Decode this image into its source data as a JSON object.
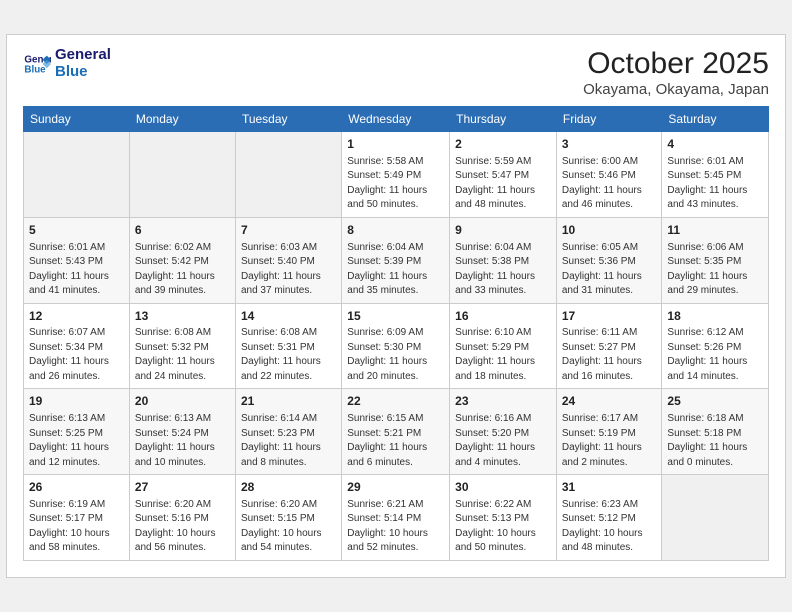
{
  "header": {
    "logo_line1": "General",
    "logo_line2": "Blue",
    "month": "October 2025",
    "location": "Okayama, Okayama, Japan"
  },
  "weekdays": [
    "Sunday",
    "Monday",
    "Tuesday",
    "Wednesday",
    "Thursday",
    "Friday",
    "Saturday"
  ],
  "weeks": [
    [
      {
        "day": "",
        "info": ""
      },
      {
        "day": "",
        "info": ""
      },
      {
        "day": "",
        "info": ""
      },
      {
        "day": "1",
        "info": "Sunrise: 5:58 AM\nSunset: 5:49 PM\nDaylight: 11 hours\nand 50 minutes."
      },
      {
        "day": "2",
        "info": "Sunrise: 5:59 AM\nSunset: 5:47 PM\nDaylight: 11 hours\nand 48 minutes."
      },
      {
        "day": "3",
        "info": "Sunrise: 6:00 AM\nSunset: 5:46 PM\nDaylight: 11 hours\nand 46 minutes."
      },
      {
        "day": "4",
        "info": "Sunrise: 6:01 AM\nSunset: 5:45 PM\nDaylight: 11 hours\nand 43 minutes."
      }
    ],
    [
      {
        "day": "5",
        "info": "Sunrise: 6:01 AM\nSunset: 5:43 PM\nDaylight: 11 hours\nand 41 minutes."
      },
      {
        "day": "6",
        "info": "Sunrise: 6:02 AM\nSunset: 5:42 PM\nDaylight: 11 hours\nand 39 minutes."
      },
      {
        "day": "7",
        "info": "Sunrise: 6:03 AM\nSunset: 5:40 PM\nDaylight: 11 hours\nand 37 minutes."
      },
      {
        "day": "8",
        "info": "Sunrise: 6:04 AM\nSunset: 5:39 PM\nDaylight: 11 hours\nand 35 minutes."
      },
      {
        "day": "9",
        "info": "Sunrise: 6:04 AM\nSunset: 5:38 PM\nDaylight: 11 hours\nand 33 minutes."
      },
      {
        "day": "10",
        "info": "Sunrise: 6:05 AM\nSunset: 5:36 PM\nDaylight: 11 hours\nand 31 minutes."
      },
      {
        "day": "11",
        "info": "Sunrise: 6:06 AM\nSunset: 5:35 PM\nDaylight: 11 hours\nand 29 minutes."
      }
    ],
    [
      {
        "day": "12",
        "info": "Sunrise: 6:07 AM\nSunset: 5:34 PM\nDaylight: 11 hours\nand 26 minutes."
      },
      {
        "day": "13",
        "info": "Sunrise: 6:08 AM\nSunset: 5:32 PM\nDaylight: 11 hours\nand 24 minutes."
      },
      {
        "day": "14",
        "info": "Sunrise: 6:08 AM\nSunset: 5:31 PM\nDaylight: 11 hours\nand 22 minutes."
      },
      {
        "day": "15",
        "info": "Sunrise: 6:09 AM\nSunset: 5:30 PM\nDaylight: 11 hours\nand 20 minutes."
      },
      {
        "day": "16",
        "info": "Sunrise: 6:10 AM\nSunset: 5:29 PM\nDaylight: 11 hours\nand 18 minutes."
      },
      {
        "day": "17",
        "info": "Sunrise: 6:11 AM\nSunset: 5:27 PM\nDaylight: 11 hours\nand 16 minutes."
      },
      {
        "day": "18",
        "info": "Sunrise: 6:12 AM\nSunset: 5:26 PM\nDaylight: 11 hours\nand 14 minutes."
      }
    ],
    [
      {
        "day": "19",
        "info": "Sunrise: 6:13 AM\nSunset: 5:25 PM\nDaylight: 11 hours\nand 12 minutes."
      },
      {
        "day": "20",
        "info": "Sunrise: 6:13 AM\nSunset: 5:24 PM\nDaylight: 11 hours\nand 10 minutes."
      },
      {
        "day": "21",
        "info": "Sunrise: 6:14 AM\nSunset: 5:23 PM\nDaylight: 11 hours\nand 8 minutes."
      },
      {
        "day": "22",
        "info": "Sunrise: 6:15 AM\nSunset: 5:21 PM\nDaylight: 11 hours\nand 6 minutes."
      },
      {
        "day": "23",
        "info": "Sunrise: 6:16 AM\nSunset: 5:20 PM\nDaylight: 11 hours\nand 4 minutes."
      },
      {
        "day": "24",
        "info": "Sunrise: 6:17 AM\nSunset: 5:19 PM\nDaylight: 11 hours\nand 2 minutes."
      },
      {
        "day": "25",
        "info": "Sunrise: 6:18 AM\nSunset: 5:18 PM\nDaylight: 11 hours\nand 0 minutes."
      }
    ],
    [
      {
        "day": "26",
        "info": "Sunrise: 6:19 AM\nSunset: 5:17 PM\nDaylight: 10 hours\nand 58 minutes."
      },
      {
        "day": "27",
        "info": "Sunrise: 6:20 AM\nSunset: 5:16 PM\nDaylight: 10 hours\nand 56 minutes."
      },
      {
        "day": "28",
        "info": "Sunrise: 6:20 AM\nSunset: 5:15 PM\nDaylight: 10 hours\nand 54 minutes."
      },
      {
        "day": "29",
        "info": "Sunrise: 6:21 AM\nSunset: 5:14 PM\nDaylight: 10 hours\nand 52 minutes."
      },
      {
        "day": "30",
        "info": "Sunrise: 6:22 AM\nSunset: 5:13 PM\nDaylight: 10 hours\nand 50 minutes."
      },
      {
        "day": "31",
        "info": "Sunrise: 6:23 AM\nSunset: 5:12 PM\nDaylight: 10 hours\nand 48 minutes."
      },
      {
        "day": "",
        "info": ""
      }
    ]
  ]
}
